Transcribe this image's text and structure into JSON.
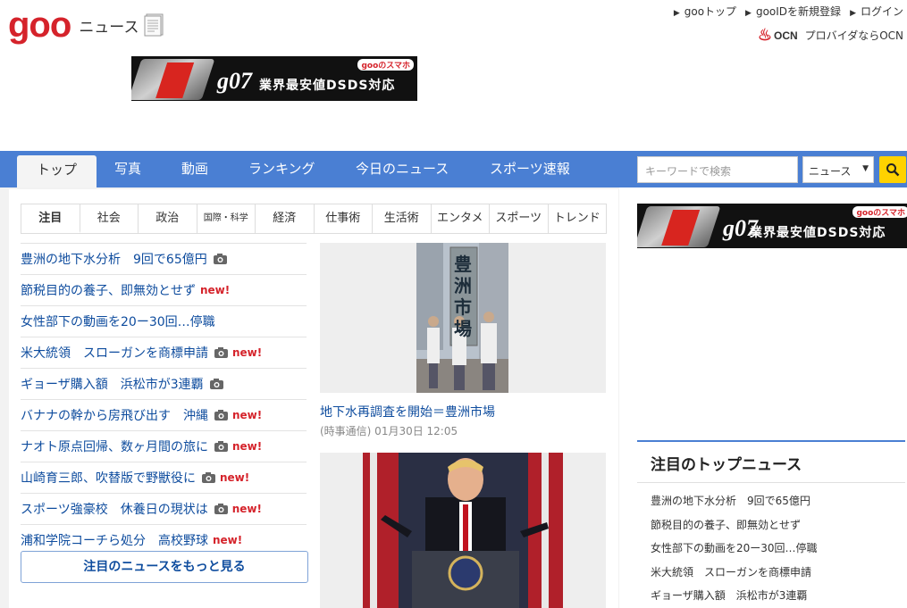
{
  "header": {
    "logo_text": "goo",
    "section_title": "ニュース",
    "top_links": [
      "gooトップ",
      "gooIDを新規登録",
      "ログイン"
    ],
    "ocn_logo": "OCN",
    "ocn_text": "プロバイダならOCN"
  },
  "banner": {
    "tag": "gooのスマホ",
    "brand": "g07",
    "text": "業界最安値DSDS対応"
  },
  "nav": {
    "items": [
      "トップ",
      "写真",
      "動画",
      "ランキング",
      "今日のニュース",
      "スポーツ速報"
    ],
    "search_placeholder": "キーワードで検索",
    "search_scope": "ニュース"
  },
  "subtabs": [
    "注目",
    "社会",
    "政治",
    "国際・科学",
    "経済",
    "仕事術",
    "生活術",
    "エンタメ",
    "スポーツ",
    "トレンド"
  ],
  "news_list": [
    {
      "title": "豊洲の地下水分析　9回で65億円",
      "photo": true,
      "new": false
    },
    {
      "title": "節税目的の養子、即無効とせず",
      "photo": false,
      "new": true
    },
    {
      "title": "女性部下の動画を20ー30回…停職",
      "photo": false,
      "new": false
    },
    {
      "title": "米大統領　スローガンを商標申請",
      "photo": true,
      "new": true
    },
    {
      "title": "ギョーザ購入額　浜松市が3連覇",
      "photo": true,
      "new": false
    },
    {
      "title": "バナナの幹から房飛び出す　沖縄",
      "photo": true,
      "new": true
    },
    {
      "title": "ナオト原点回帰、数ヶ月間の旅に",
      "photo": true,
      "new": true
    },
    {
      "title": "山崎育三郎、吹替版で野獣役に",
      "photo": true,
      "new": true
    },
    {
      "title": "スポーツ強豪校　休養日の現状は",
      "photo": true,
      "new": true
    },
    {
      "title": "浦和学院コーチら処分　高校野球",
      "photo": false,
      "new": true
    }
  ],
  "new_label": "new!",
  "more_button": "注目のニュースをもっと見る",
  "feature": {
    "sign_text": "豊洲市場",
    "caption": "地下水再調査を開始＝豊洲市場",
    "source": "(時事通信) 01月30日 12:05"
  },
  "sidebar": {
    "heading": "注目のトップニュース",
    "items": [
      "豊洲の地下水分析　9回で65億円",
      "節税目的の養子、即無効とせず",
      "女性部下の動画を20ー30回…停職",
      "米大統領　スローガンを商標申請",
      "ギョーザ購入額　浜松市が3連覇"
    ]
  },
  "colors": {
    "brand_red": "#d5232b",
    "nav_blue": "#4a7fd3",
    "link_blue": "#0e4c9e",
    "search_yellow": "#ffd200"
  }
}
